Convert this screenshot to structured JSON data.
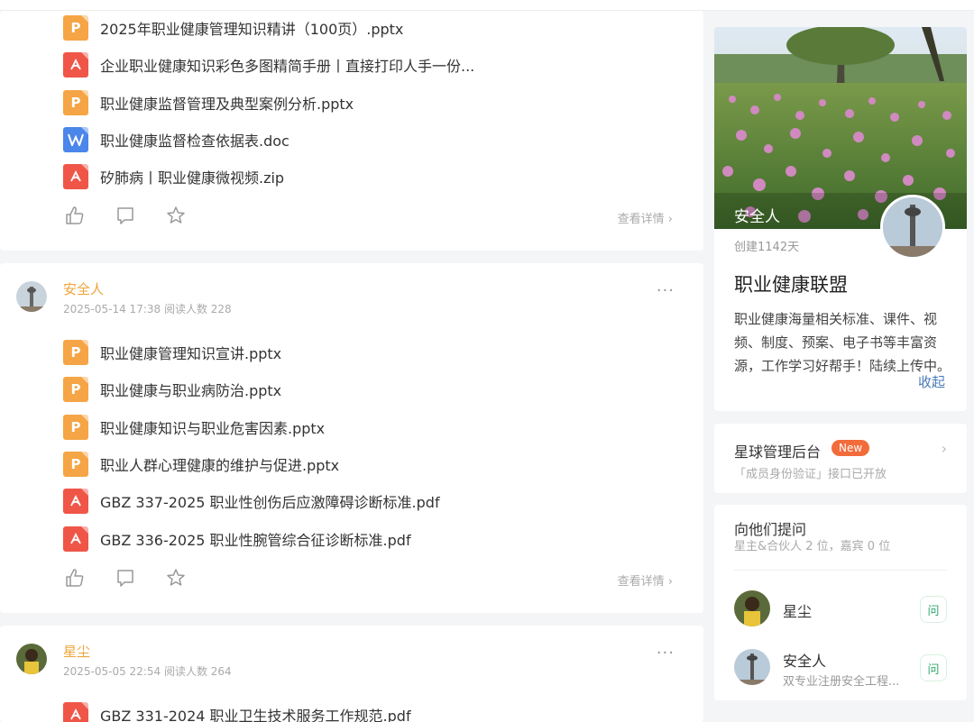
{
  "post1": {
    "files": [
      {
        "type": "ppt",
        "name": "2025年职业健康管理知识精讲（100页）.pptx"
      },
      {
        "type": "pdf",
        "name": "企业职业健康知识彩色多图精简手册丨直接打印人手一份..."
      },
      {
        "type": "ppt",
        "name": "职业健康监督管理及典型案例分析.pptx"
      },
      {
        "type": "doc",
        "name": "职业健康监督检查依据表.doc"
      },
      {
        "type": "pdf",
        "name": "矽肺病丨职业健康微视频.zip"
      }
    ],
    "detail": "查看详情 ›"
  },
  "post2": {
    "author": "安全人",
    "meta": "2025-05-14 17:38  阅读人数 228",
    "more": "···",
    "files": [
      {
        "type": "ppt",
        "name": "职业健康管理知识宣讲.pptx"
      },
      {
        "type": "ppt",
        "name": "职业健康与职业病防治.pptx"
      },
      {
        "type": "ppt",
        "name": "职业健康知识与职业危害因素.pptx"
      },
      {
        "type": "ppt",
        "name": "职业人群心理健康的维护与促进.pptx"
      },
      {
        "type": "pdf",
        "name": "GBZ  337-2025 职业性创伤后应激障碍诊断标准.pdf"
      },
      {
        "type": "pdf",
        "name": "GBZ 336-2025 职业性腕管综合征诊断标准.pdf"
      }
    ],
    "detail": "查看详情 ›"
  },
  "post3": {
    "author": "星尘",
    "meta": "2025-05-05 22:54  阅读人数 264",
    "more": "···",
    "files": [
      {
        "type": "pdf",
        "name": "GBZ 331-2024 职业卫生技术服务工作规范.pdf"
      }
    ]
  },
  "sidebar": {
    "group": {
      "owner_name": "安全人",
      "created": "创建1142天",
      "title": "职业健康联盟",
      "desc": "职业健康海量相关标准、课件、视频、制度、预案、电子书等丰富资源，工作学习好帮手！陆续上传中。",
      "collapse": "收起"
    },
    "admin": {
      "title": "星球管理后台",
      "badge": "New",
      "sub": "「成员身份验证」接口已开放"
    },
    "ask": {
      "title": "向他们提问",
      "sub": "星主&合伙人 2 位，嘉宾 0 位",
      "people": [
        {
          "name": "星尘",
          "desc": "",
          "btn": "问"
        },
        {
          "name": "安全人",
          "desc": "双专业注册安全工程...",
          "btn": "问"
        }
      ]
    }
  },
  "colors": {
    "accent": "#f0a43a",
    "ppt": "#f5a545",
    "pdf": "#ef5648",
    "doc": "#4b86ea",
    "badge": "#f26b3a",
    "ask_green": "#2ea86b"
  }
}
